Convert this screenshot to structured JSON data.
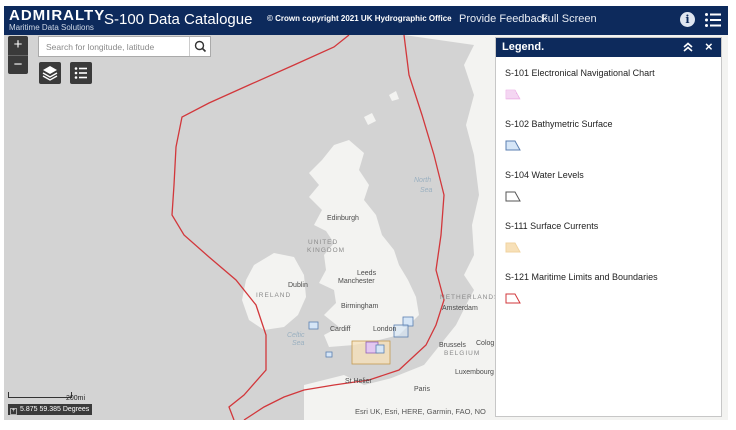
{
  "header": {
    "brand": "ADMIRALTY",
    "brand_sub": "Maritime Data Solutions",
    "title": "S-100 Data Catalogue",
    "copyright": "© Crown copyright 2021 UK Hydrographic Office",
    "feedback_link": "Provide Feedback",
    "fullscreen_link": "Full Screen",
    "info_icon": "i"
  },
  "map_controls": {
    "zoom_in": "+",
    "zoom_out": "−",
    "search_placeholder": "Search for longitude, latitude",
    "search_value": ""
  },
  "map": {
    "labels": {
      "edinburgh": "Edinburgh",
      "united": "UNITED",
      "kingdom": "KINGDOM",
      "north": "North",
      "sea": "Sea",
      "leeds": "Leeds",
      "manchester": "Manchester",
      "dublin": "Dublin",
      "ireland": "IRELAND",
      "birmingham": "Birmingham",
      "cardiff": "Cardiff",
      "london": "London",
      "celtic": "Celtic",
      "celtic_sea": "Sea",
      "amsterdam": "Amsterdam",
      "netherlands": "NETHERLANDS",
      "brussels": "Brussels",
      "belgium": "BELGIUM",
      "cologne": "Colog",
      "luxembourg": "Luxembourg",
      "st_helier": "St Helier",
      "paris": "Paris"
    },
    "scale_label": "200mi",
    "coordinates": "5.875 59.385 Degrees",
    "attribution": "Esri UK, Esri, HERE, Garmin, FAO, NO"
  },
  "legend": {
    "title": "Legend.",
    "close": "×",
    "items": [
      {
        "label": "S-101 Electronical Navigational Chart",
        "fill": "#f4c6ee",
        "stroke": "#d96fd0",
        "pattern": "dots"
      },
      {
        "label": "S-102 Bathymetric Surface",
        "fill": "#d6e6f7",
        "stroke": "#5b7fb0",
        "pattern": "solid"
      },
      {
        "label": "S-104 Water Levels",
        "fill": "#ffffff",
        "stroke": "#555555",
        "pattern": "solid"
      },
      {
        "label": "S-111 Surface Currents",
        "fill": "#f7e0b8",
        "stroke": "#f0d3a0",
        "pattern": "solid"
      },
      {
        "label": "S-121 Maritime Limits and Boundaries",
        "fill": "#ffffff",
        "stroke": "#d2373b",
        "pattern": "solid"
      }
    ]
  },
  "colors": {
    "header_bg": "#0d2a5c",
    "boundary_red": "#d2373b",
    "land": "#f3f3f1",
    "sea": "#d3d3d3"
  }
}
